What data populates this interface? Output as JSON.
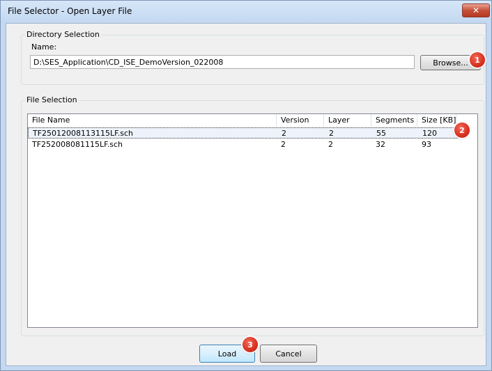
{
  "window": {
    "title": "File Selector - Open Layer File"
  },
  "directory_selection": {
    "group_label": "Directory Selection",
    "name_label": "Name:",
    "path_value": "D:\\SES_Application\\CD_ISE_DemoVersion_022008",
    "browse_label": "Browse..."
  },
  "file_selection": {
    "group_label": "File Selection",
    "columns": [
      "File Name",
      "Version",
      "Layer",
      "Segments",
      "Size [KB]"
    ],
    "rows": [
      {
        "name": "TF25012008113115LF.sch",
        "version": "2",
        "layer": "2",
        "segments": "55",
        "size": "120",
        "selected": true
      },
      {
        "name": "TF252008081115LF.sch",
        "version": "2",
        "layer": "2",
        "segments": "32",
        "size": "93",
        "selected": false
      }
    ]
  },
  "buttons": {
    "load_label": "Load",
    "cancel_label": "Cancel"
  },
  "annotations": [
    "1",
    "2",
    "3"
  ],
  "colors": {
    "annotation_badge": "#d8301e",
    "title_gradient": "#c4d9f1"
  }
}
